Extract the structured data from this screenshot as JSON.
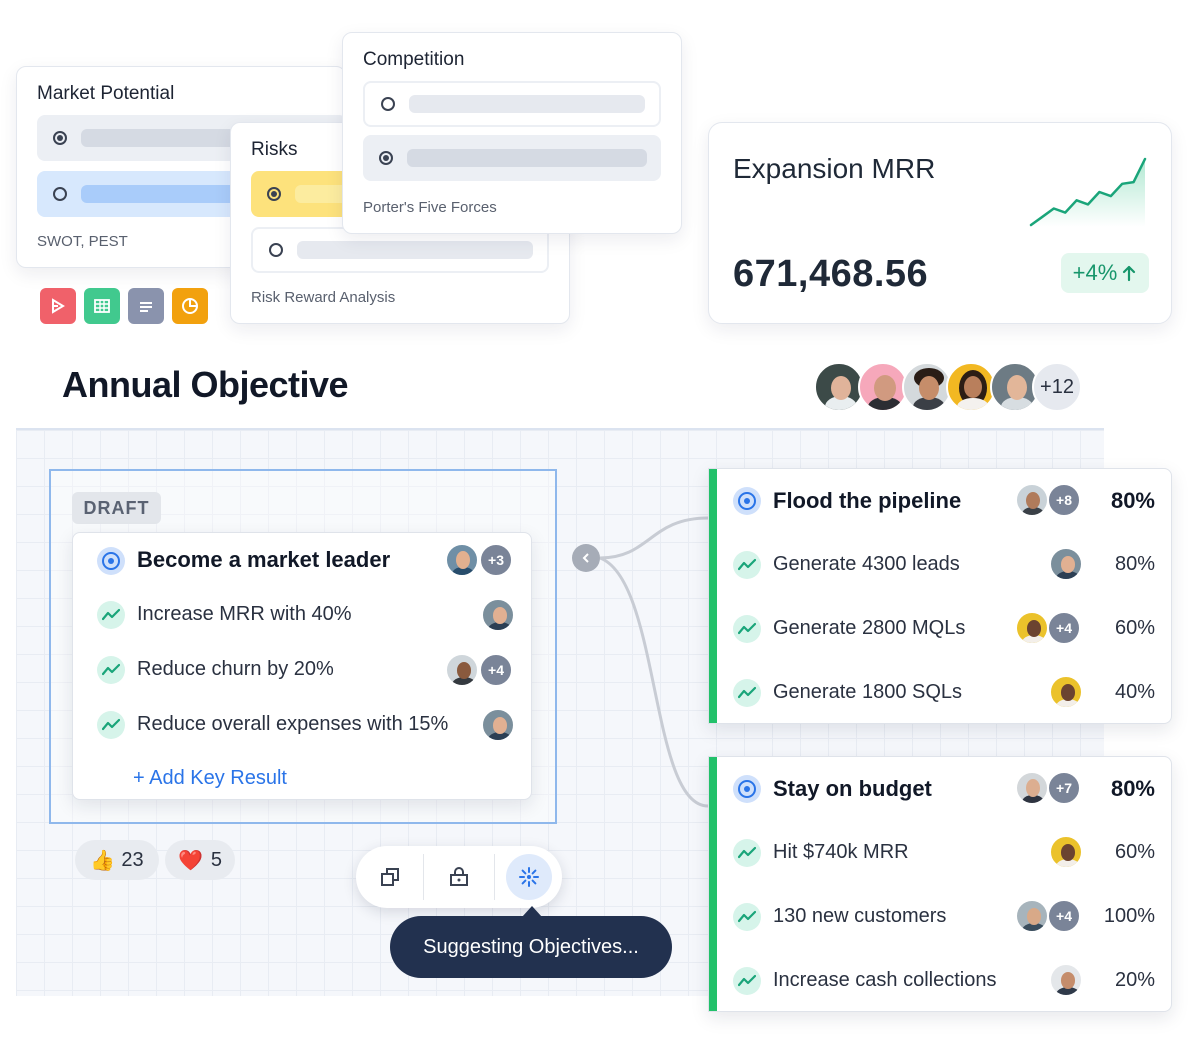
{
  "market_card": {
    "title": "Market Potential",
    "caption": "SWOT, PEST"
  },
  "risks_card": {
    "title": "Risks",
    "caption": "Risk Reward Analysis"
  },
  "competition_card": {
    "title": "Competition",
    "caption": "Porter's Five Forces"
  },
  "file_icons": [
    "pdf-icon",
    "spreadsheet-icon",
    "document-icon",
    "chart-icon"
  ],
  "mrr_card": {
    "title": "Expansion MRR",
    "value": "671,468.56",
    "change": "+4%",
    "sparkline": [
      2,
      3,
      4,
      3.5,
      5,
      4.5,
      6,
      5.5,
      7,
      7.2,
      10
    ]
  },
  "board": {
    "title": "Annual Objective",
    "team_more": "+12"
  },
  "draft": {
    "badge": "DRAFT",
    "objective": "Become a market leader",
    "objective_more": "+3",
    "key_results": [
      {
        "label": "Increase MRR with 40%",
        "more": ""
      },
      {
        "label": "Reduce churn by 20%",
        "more": "+4"
      },
      {
        "label": "Reduce overall expenses with 15%",
        "more": ""
      }
    ],
    "add_label": "+ Add Key Result"
  },
  "reactions": [
    {
      "emoji": "👍",
      "count": "23"
    },
    {
      "emoji": "❤️",
      "count": "5"
    }
  ],
  "toolbar": {
    "tooltip": "Suggesting Objectives..."
  },
  "objectives": [
    {
      "title": "Flood the pipeline",
      "more": "+8",
      "percent": "80%",
      "key_results": [
        {
          "label": "Generate 4300 leads",
          "more": "",
          "percent": "80%"
        },
        {
          "label": "Generate 2800 MQLs",
          "more": "+4",
          "percent": "60%"
        },
        {
          "label": "Generate 1800 SQLs",
          "more": "",
          "percent": "40%"
        }
      ]
    },
    {
      "title": "Stay on budget",
      "more": "+7",
      "percent": "80%",
      "key_results": [
        {
          "label": "Hit $740k MRR",
          "more": "",
          "percent": "60%"
        },
        {
          "label": "130 new customers",
          "more": "+4",
          "percent": "100%"
        },
        {
          "label": "Increase cash collections",
          "more": "",
          "percent": "20%"
        }
      ]
    }
  ],
  "colors": {
    "accent": "#2a74e8",
    "green": "#22c16a",
    "tooltip_bg": "#22314f",
    "positive_bg": "#e3f7ee",
    "positive_text": "#17966b"
  }
}
